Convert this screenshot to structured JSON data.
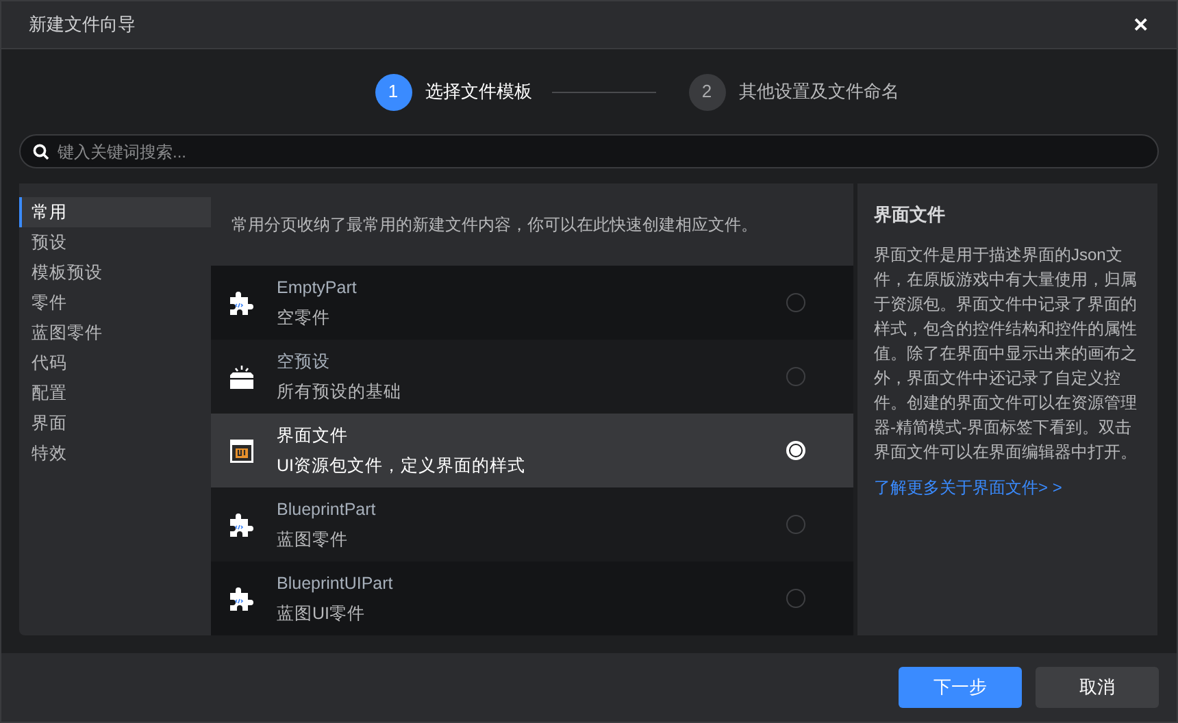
{
  "window": {
    "title": "新建文件向导",
    "close": "✕"
  },
  "steps": [
    {
      "number": "1",
      "label": "选择文件模板",
      "selected": true
    },
    {
      "number": "2",
      "label": "其他设置及文件命名",
      "selected": false
    }
  ],
  "search": {
    "placeholder": "键入关键词搜索..."
  },
  "sidebar": {
    "items": [
      {
        "label": "常用",
        "selected": true
      },
      {
        "label": "预设",
        "selected": false
      },
      {
        "label": "模板预设",
        "selected": false
      },
      {
        "label": "零件",
        "selected": false
      },
      {
        "label": "蓝图零件",
        "selected": false
      },
      {
        "label": "代码",
        "selected": false
      },
      {
        "label": "配置",
        "selected": false
      },
      {
        "label": "界面",
        "selected": false
      },
      {
        "label": "特效",
        "selected": false
      }
    ]
  },
  "description": "常用分页收纳了最常用的新建文件内容，你可以在此快速创建相应文件。",
  "templates": [
    {
      "kind": "puzzle",
      "title": "EmptyPart",
      "subtitle": "空零件",
      "selected": false
    },
    {
      "kind": "tray",
      "title": "空预设",
      "subtitle": "所有预设的基础",
      "selected": false
    },
    {
      "kind": "ui",
      "title": "界面文件",
      "subtitle": "UI资源包文件，定义界面的样式",
      "selected": true
    },
    {
      "kind": "puzzle",
      "title": "BlueprintPart",
      "subtitle": "蓝图零件",
      "selected": false
    },
    {
      "kind": "puzzle",
      "title": "BlueprintUIPart",
      "subtitle": "蓝图UI零件",
      "selected": false
    }
  ],
  "details": {
    "title": "界面文件",
    "body": "界面文件是用于描述界面的Json文件，在原版游戏中有大量使用，归属于资源包。界面文件中记录了界面的样式，包含的控件结构和控件的属性值。除了在界面中显示出来的画布之外，界面文件中还记录了自定义控件。创建的界面文件可以在资源管理器-精简模式-界面标签下看到。双击界面文件可以在界面编辑器中打开。",
    "link": "了解更多关于界面文件> >"
  },
  "buttons": {
    "next": "下一步",
    "cancel": "取消"
  }
}
